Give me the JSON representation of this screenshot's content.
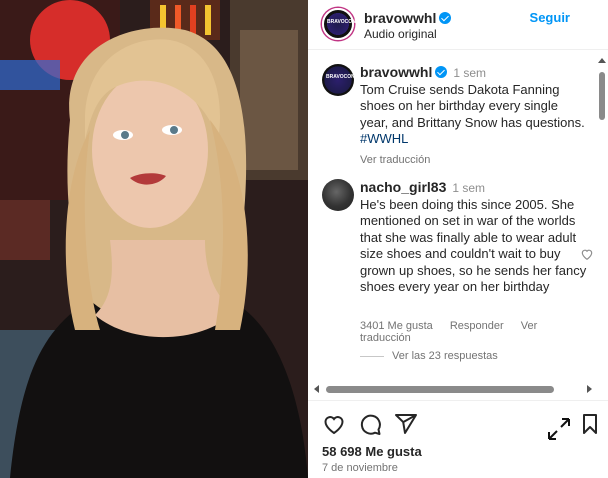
{
  "header": {
    "username": "bravowwhl",
    "subtitle": "Audio original",
    "follow_label": "Seguir",
    "more_label": "···",
    "avatar_text": "BRAVOCON"
  },
  "post": {
    "username": "bravowwhl",
    "time": "1 sem",
    "caption": "Tom Cruise sends Dakota Fanning shoes on her birthday every single year, and Brittany Snow has questions.",
    "hashtag": "#WWHL",
    "translate_label": "Ver traducción"
  },
  "comment": {
    "username": "nacho_girl83",
    "time": "1 sem",
    "text": "He's been doing this since 2005. She mentioned on set in war of the worlds that she was finally able to wear adult size shoes and couldn't wait to buy grown up shoes, so he sends her fancy shoes every year on her birthday",
    "likes_label": "3401 Me gusta",
    "reply_label": "Responder",
    "translate_label": "Ver traducción",
    "replies_label": "Ver las 23 respuestas"
  },
  "footer": {
    "likes": "58 698 Me gusta",
    "date": "7 de noviembre"
  },
  "colors": {
    "accent": "#0095f6",
    "text": "#262626",
    "muted": "#737373"
  },
  "icons": [
    "heart-icon",
    "comment-icon",
    "share-icon",
    "bookmark-icon",
    "expand-icon",
    "verified-icon",
    "more-icon"
  ]
}
